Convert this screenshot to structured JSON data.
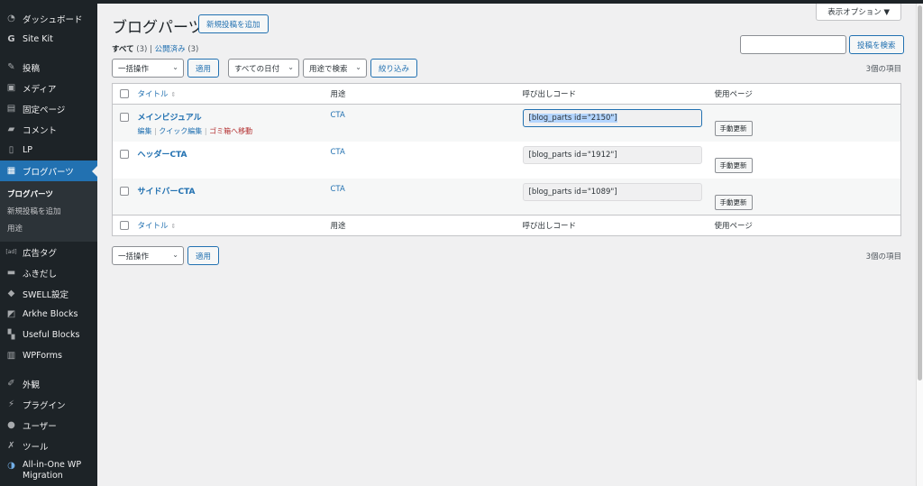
{
  "sidebar": {
    "items": [
      {
        "label": "ダッシュボード",
        "icon": "dashboard-icon"
      },
      {
        "label": "Site Kit",
        "icon": "google-g-icon"
      },
      {
        "label": "投稿",
        "icon": "pin-icon"
      },
      {
        "label": "メディア",
        "icon": "media-icon"
      },
      {
        "label": "固定ページ",
        "icon": "page-icon"
      },
      {
        "label": "コメント",
        "icon": "comment-icon"
      },
      {
        "label": "LP",
        "icon": "document-icon"
      },
      {
        "label": "ブログパーツ",
        "icon": "layout-icon"
      },
      {
        "label": "広告タグ",
        "icon": "ad-icon"
      },
      {
        "label": "ふきだし",
        "icon": "speech-bubble-icon"
      },
      {
        "label": "SWELL設定",
        "icon": "swell-icon"
      },
      {
        "label": "Arkhe Blocks",
        "icon": "arkhe-icon"
      },
      {
        "label": "Useful Blocks",
        "icon": "grid-icon"
      },
      {
        "label": "WPForms",
        "icon": "forms-icon"
      },
      {
        "label": "外観",
        "icon": "brush-icon"
      },
      {
        "label": "プラグイン",
        "icon": "plugin-icon"
      },
      {
        "label": "ユーザー",
        "icon": "user-icon"
      },
      {
        "label": "ツール",
        "icon": "wrench-icon"
      },
      {
        "label": "All-in-One WP Migration",
        "icon": "migration-icon"
      }
    ],
    "submenu": [
      "ブログパーツ",
      "新規投稿を追加",
      "用途"
    ]
  },
  "header": {
    "title": "ブログパーツ",
    "add_new": "新規投稿を追加",
    "screen_options": "表示オプション ▼"
  },
  "filters": {
    "all": "すべて",
    "all_count": "(3)",
    "sep": "|",
    "published": "公開済み",
    "published_count": "(3)",
    "bulk_action": "一括操作",
    "apply": "適用",
    "dates": "すべての日付",
    "usage": "用途で検索",
    "filter_button": "絞り込み",
    "search_button": "投稿を検索",
    "item_count": "3個の項目"
  },
  "table": {
    "columns": [
      "タイトル",
      "用途",
      "呼び出しコード",
      "使用ページ"
    ],
    "rows": [
      {
        "title": "メインビジュアル",
        "usage": "CTA",
        "code": "[blog_parts id=\"2150\"]",
        "action": "手動更新"
      },
      {
        "title": "ヘッダーCTA",
        "usage": "CTA",
        "code": "[blog_parts id=\"1912\"]",
        "action": "手動更新"
      },
      {
        "title": "サイドバーCTA",
        "usage": "CTA",
        "code": "[blog_parts id=\"1089\"]",
        "action": "手動更新"
      }
    ],
    "row_actions": {
      "edit": "編集",
      "quick_edit": "クイック編集",
      "trash": "ゴミ箱へ移動",
      "sep": "|"
    }
  },
  "colors": {
    "accent": "#2271b1",
    "sidebar": "#1d2327",
    "trash": "#b32d2e"
  }
}
